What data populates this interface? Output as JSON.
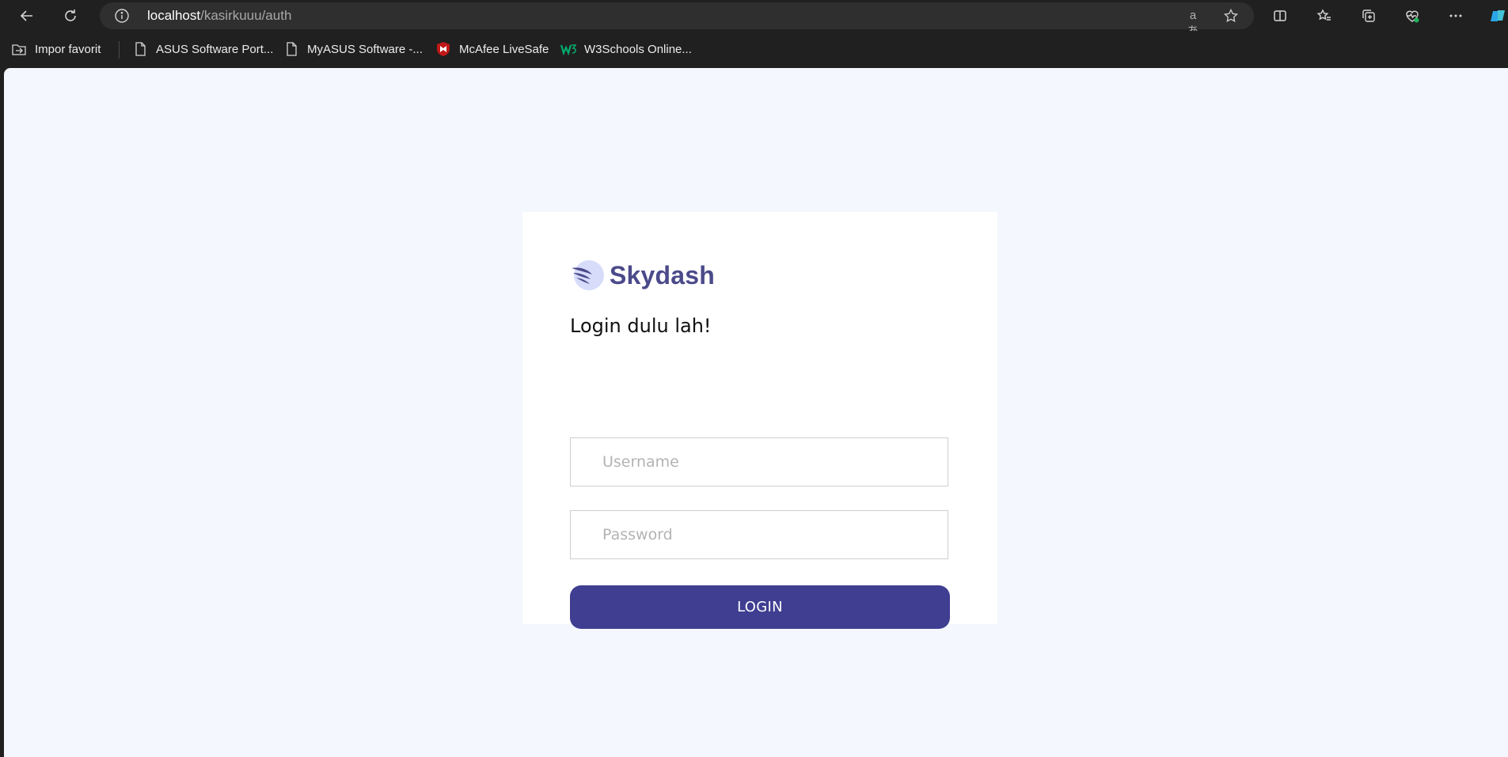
{
  "browser": {
    "url_host": "localhost",
    "url_path": "/kasirkuuu/auth",
    "translate_glyph": "aあ",
    "bookmarks": [
      {
        "label": "Impor favorit",
        "icon": "import-favorites-icon"
      },
      {
        "label": "ASUS Software Port...",
        "icon": "page-icon"
      },
      {
        "label": "MyASUS Software -...",
        "icon": "page-icon"
      },
      {
        "label": "McAfee LiveSafe",
        "icon": "mcafee-icon"
      },
      {
        "label": "W3Schools Online...",
        "icon": "w3schools-icon"
      }
    ]
  },
  "login": {
    "brand": "Skydash",
    "heading": "Login dulu lah!",
    "username_placeholder": "Username",
    "password_placeholder": "Password",
    "button_label": "LOGIN"
  },
  "colors": {
    "page_background": "#f4f7fd",
    "brand_text": "#4b4a8a",
    "button": "#3f3e91"
  }
}
